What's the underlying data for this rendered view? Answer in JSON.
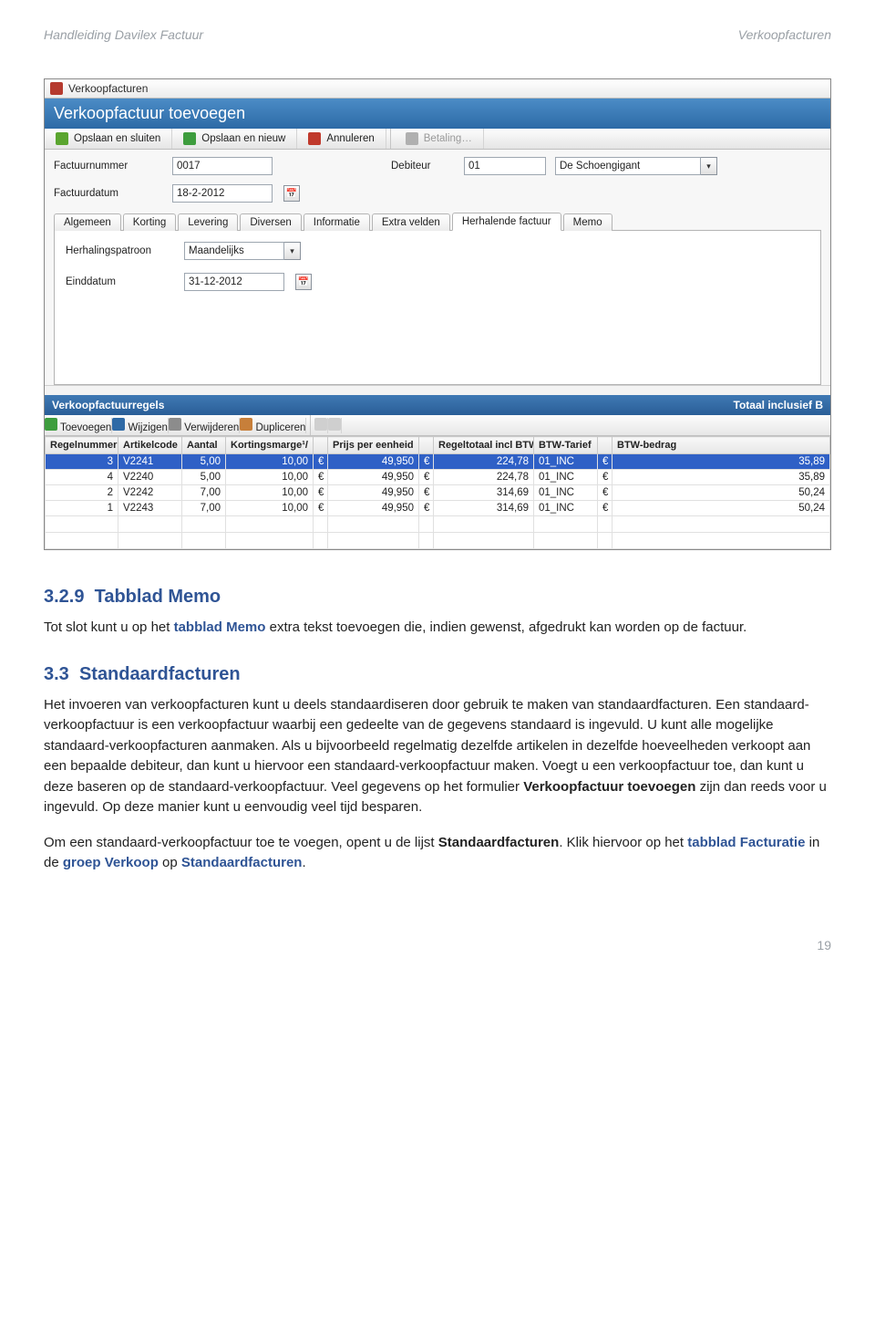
{
  "doc_header": {
    "left": "Handleiding Davilex Factuur",
    "right": "Verkoopfacturen"
  },
  "window": {
    "title": "Verkoopfacturen",
    "heading": "Verkoopfactuur toevoegen",
    "toolbar": {
      "save_close": "Opslaan en sluiten",
      "save_new": "Opslaan en nieuw",
      "cancel": "Annuleren",
      "payment": "Betaling…"
    },
    "fields": {
      "invoice_number_label": "Factuurnummer",
      "invoice_number": "0017",
      "debtor_label": "Debiteur",
      "debtor_code": "01",
      "debtor_name": "De Schoengigant",
      "invoice_date_label": "Factuurdatum",
      "invoice_date": "18-2-2012"
    },
    "tabs": [
      {
        "label": "Algemeen"
      },
      {
        "label": "Korting"
      },
      {
        "label": "Levering"
      },
      {
        "label": "Diversen"
      },
      {
        "label": "Informatie"
      },
      {
        "label": "Extra velden"
      },
      {
        "label": "Herhalende factuur"
      },
      {
        "label": "Memo"
      }
    ],
    "tab_panel": {
      "pattern_label": "Herhalingspatroon",
      "pattern_value": "Maandelijks",
      "enddate_label": "Einddatum",
      "enddate_value": "31-12-2012"
    },
    "lines_section": {
      "title": "Verkoopfactuurregels",
      "total_label": "Totaal inclusief B"
    },
    "lines_toolbar": {
      "add": "Toevoegen",
      "edit": "Wijzigen",
      "delete": "Verwijderen",
      "duplicate": "Dupliceren",
      "prev": "⇐",
      "next": "⇒"
    },
    "columns": {
      "regelnr": "Regelnummer",
      "artikel": "Artikelcode",
      "aantal": "Aantal",
      "marge": "Kortingsmarge¹/",
      "ppe": "Prijs per eenheid",
      "regeltot": "Regeltotaal incl BTW",
      "tarief": "BTW-Tarief",
      "btwbedrag": "BTW-bedrag"
    },
    "rows": [
      {
        "regelnr": "3",
        "artikel": "V2241",
        "aantal": "5,00",
        "marge": "10,00",
        "cur": "€",
        "ppe": "49,950",
        "tot": "224,78",
        "tarief": "01_INC",
        "btw": "35,89",
        "sel": true
      },
      {
        "regelnr": "4",
        "artikel": "V2240",
        "aantal": "5,00",
        "marge": "10,00",
        "cur": "€",
        "ppe": "49,950",
        "tot": "224,78",
        "tarief": "01_INC",
        "btw": "35,89"
      },
      {
        "regelnr": "2",
        "artikel": "V2242",
        "aantal": "7,00",
        "marge": "10,00",
        "cur": "€",
        "ppe": "49,950",
        "tot": "314,69",
        "tarief": "01_INC",
        "btw": "50,24"
      },
      {
        "regelnr": "1",
        "artikel": "V2243",
        "aantal": "7,00",
        "marge": "10,00",
        "cur": "€",
        "ppe": "49,950",
        "tot": "314,69",
        "tarief": "01_INC",
        "btw": "50,24"
      }
    ]
  },
  "text": {
    "sec329_num": "3.2.9",
    "sec329_title": "Tabblad Memo",
    "p329a": "Tot slot kunt u op het ",
    "p329b": "tabblad Memo",
    "p329c": " extra tekst toevoegen die, indien gewenst, afgedrukt kan worden op de factuur.",
    "sec33_num": "3.3",
    "sec33_title": "Standaardfacturen",
    "p33a": "Het invoeren van verkoopfacturen kunt u deels standaardiseren door gebruik te maken van standaardfacturen. Een standaard-verkoopfactuur is een verkoopfactuur waarbij een gedeelte van de gegevens standaard is ingevuld. U kunt alle mogelijke standaard-verkoopfacturen aanmaken. Als u bijvoorbeeld regelmatig dezelfde artikelen in dezelfde hoeveelheden verkoopt aan een bepaalde debiteur, dan kunt u hiervoor een standaard-verkoopfactuur maken. Voegt u een verkoopfactuur toe, dan kunt u deze baseren op de standaard-verkoopfactuur. Veel gegevens op het formulier ",
    "p33a_bold": "Verkoopfactuur toevoegen",
    "p33a_end": " zijn dan reeds voor u ingevuld. Op deze manier kunt u eenvoudig veel tijd besparen.",
    "p33b": "Om een standaard-verkoopfactuur toe te voegen, opent u de lijst ",
    "p33b_bold": "Standaardfacturen",
    "p33b_mid": ". Klik hiervoor op het ",
    "p33b_term1": "tabblad Facturatie",
    "p33b_mid2": " in de ",
    "p33b_term2": "groep Verkoop",
    "p33b_mid3": " op ",
    "p33b_term3": "Standaardfacturen",
    "p33b_end": "."
  },
  "page_number": "19"
}
